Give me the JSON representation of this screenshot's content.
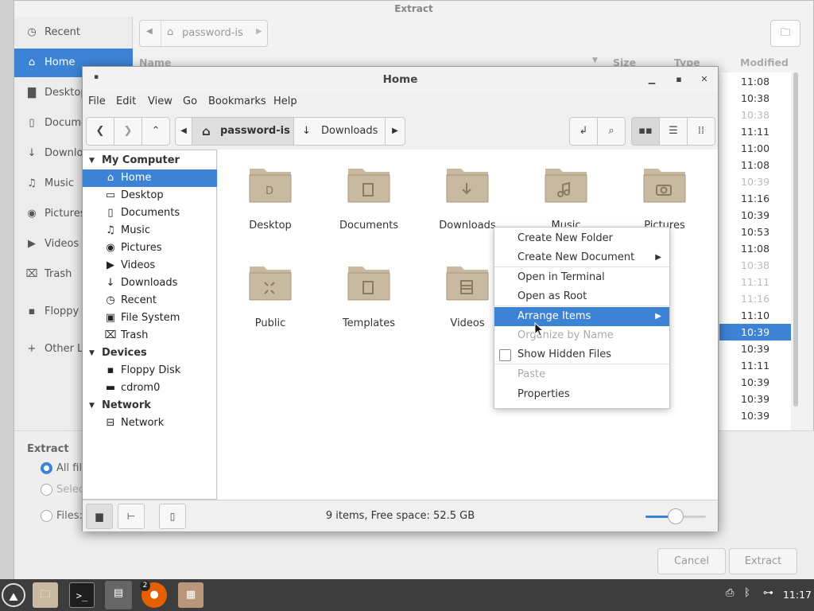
{
  "background_dialog": {
    "title": "Extract",
    "sidebar": [
      {
        "label": "Recent",
        "icon": "clock-icon"
      },
      {
        "label": "Home",
        "icon": "home-icon",
        "selected": true
      },
      {
        "label": "Desktop",
        "icon": "folder-icon"
      },
      {
        "label": "Documents",
        "icon": "document-icon"
      },
      {
        "label": "Downloads",
        "icon": "download-icon"
      },
      {
        "label": "Music",
        "icon": "music-icon"
      },
      {
        "label": "Pictures",
        "icon": "camera-icon"
      },
      {
        "label": "Videos",
        "icon": "video-icon"
      },
      {
        "label": "Trash",
        "icon": "trash-icon"
      },
      {
        "label": "Floppy Disk",
        "icon": "floppy-icon"
      },
      {
        "label": "Other Locations",
        "icon": "plus-icon"
      }
    ],
    "path_label": "password-is",
    "columns": {
      "name": "Name",
      "size": "Size",
      "type": "Type",
      "modified": "Modified"
    },
    "modified_times": [
      "11:08",
      "10:38",
      "10:38",
      "11:11",
      "11:00",
      "11:08",
      "10:39",
      "11:16",
      "10:39",
      "10:53",
      "11:08",
      "10:38",
      "11:11",
      "11:16",
      "11:10",
      "10:39",
      "10:39",
      "11:11",
      "10:39",
      "10:39",
      "10:39"
    ],
    "selected_time_index": 15,
    "extract_heading": "Extract",
    "options": [
      "All files",
      "Selected files",
      "Files:"
    ],
    "cancel_label": "Cancel",
    "extract_label": "Extract"
  },
  "window": {
    "title": "Home",
    "menu": [
      "File",
      "Edit",
      "View",
      "Go",
      "Bookmarks",
      "Help"
    ],
    "breadcrumb": [
      "password-is",
      "Downloads"
    ],
    "sidebar": {
      "sections": [
        {
          "header": "My Computer",
          "items": [
            {
              "label": "Home",
              "icon": "home-icon",
              "selected": true
            },
            {
              "label": "Desktop",
              "icon": "desktop-icon"
            },
            {
              "label": "Documents",
              "icon": "document-icon"
            },
            {
              "label": "Music",
              "icon": "music-icon"
            },
            {
              "label": "Pictures",
              "icon": "camera-icon"
            },
            {
              "label": "Videos",
              "icon": "video-icon"
            },
            {
              "label": "Downloads",
              "icon": "download-icon"
            },
            {
              "label": "Recent",
              "icon": "clock-icon"
            },
            {
              "label": "File System",
              "icon": "drive-icon"
            },
            {
              "label": "Trash",
              "icon": "trash-icon"
            }
          ]
        },
        {
          "header": "Devices",
          "items": [
            {
              "label": "Floppy Disk",
              "icon": "floppy-icon"
            },
            {
              "label": "cdrom0",
              "icon": "disc-drive-icon"
            }
          ]
        },
        {
          "header": "Network",
          "items": [
            {
              "label": "Network",
              "icon": "network-icon"
            }
          ]
        }
      ]
    },
    "files": [
      {
        "label": "Desktop",
        "emblem": "D"
      },
      {
        "label": "Documents",
        "emblem": "doc"
      },
      {
        "label": "Downloads",
        "emblem": "down"
      },
      {
        "label": "Music",
        "emblem": "music"
      },
      {
        "label": "Pictures",
        "emblem": "camera"
      },
      {
        "label": "Public",
        "emblem": "share"
      },
      {
        "label": "Templates",
        "emblem": "doc"
      },
      {
        "label": "Videos",
        "emblem": "film"
      }
    ],
    "status": "9 items, Free space: 52.5 GB",
    "zoom_fraction": 0.5
  },
  "context_menu": {
    "items": [
      {
        "label": "Create New Folder"
      },
      {
        "label": "Create New Document",
        "submenu": true
      },
      {
        "label": "Open in Terminal"
      },
      {
        "label": "Open as Root"
      },
      {
        "label": "Arrange Items",
        "submenu": true,
        "highlighted": true
      },
      {
        "label": "Organize by Name",
        "disabled": true
      },
      {
        "label": "Show Hidden Files",
        "checkbox": true,
        "checked": false
      },
      {
        "label": "Paste",
        "disabled": true
      },
      {
        "label": "Properties"
      }
    ]
  },
  "taskbar": {
    "firefox_badge": "2",
    "clock": "11:17"
  },
  "colors": {
    "accent": "#3d83d5",
    "folder": "#c8b9a0"
  }
}
